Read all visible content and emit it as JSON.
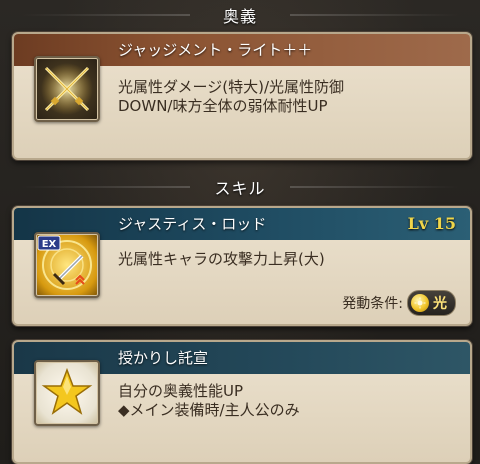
{
  "ougi": {
    "header": "奥義",
    "name": "ジャッジメント・ライト＋＋",
    "desc_line1": "光属性ダメージ(特大)/光属性防御",
    "desc_line2": "DOWN/味方全体の弱体耐性UP",
    "icon": "crossed-swords-icon"
  },
  "skill": {
    "header": "スキル",
    "name": "ジャスティス・ロッド",
    "level": "Lv 15",
    "desc": "光属性キャラの攻撃力上昇(大)",
    "condition_label": "発動条件:",
    "element": "光",
    "icon": "ex-sword-icon",
    "badge": "EX"
  },
  "support": {
    "name": "授かりし託宣",
    "desc_line1": "自分の奥義性能UP",
    "desc_line2": "◆メイン装備時/主人公のみ",
    "icon": "star-icon"
  },
  "colors": {
    "light_element": "#f2c62a",
    "level_text": "#f0d64a",
    "ougi_title": "#8b5332",
    "skill_title": "#1e4a60"
  }
}
